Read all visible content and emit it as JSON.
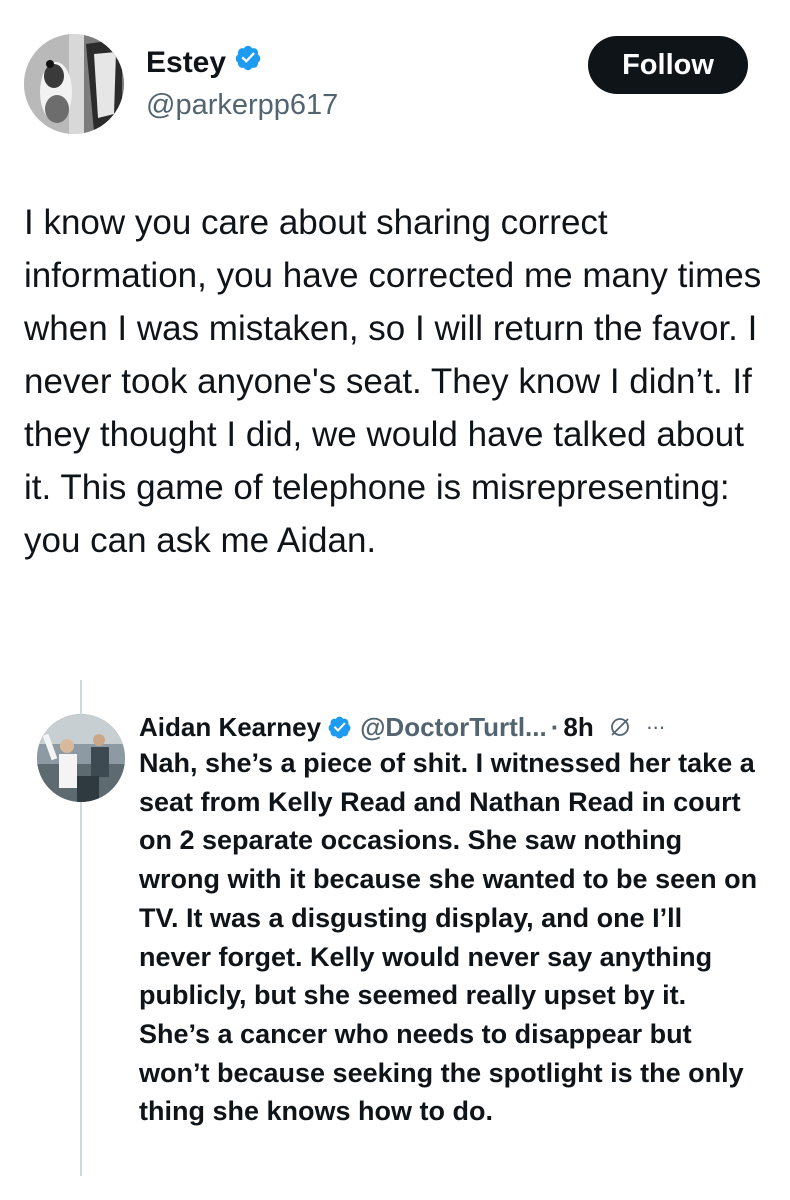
{
  "author": {
    "display_name": "Estey",
    "handle": "@parkerpp617",
    "verified": true,
    "avatar_icon": "profile-photo"
  },
  "follow_button": {
    "label": "Follow"
  },
  "tweet": {
    "text": "I know you care about sharing correct information, you have corrected me many times when I was mistaken, so I will return the favor. I never took anyone's seat. They know I didn’t. If they thought I did, we would have talked about it. This game of telephone is misrepresenting: you can ask me Aidan."
  },
  "quoted_reply": {
    "display_name": "Aidan Kearney",
    "handle": "@DoctorTurtl...",
    "separator": "·",
    "time": "8h",
    "verified": true,
    "text": "Nah, she’s a piece of shit. I witnessed her take a seat from Kelly Read and Nathan Read in court on 2 separate occasions. She saw nothing wrong with it because she wanted to be seen on TV. It was a disgusting display, and one I’ll never forget. Kelly would never say anything publicly, but she seemed really upset by it. She’s a cancer who needs to disappear but won’t because seeking the spotlight is the only thing she knows how to do."
  },
  "icons": {
    "verified": "verified-badge-icon",
    "grok": "grok-icon",
    "more": "more-icon"
  },
  "colors": {
    "verified_blue": "#1d9bf0",
    "text_primary": "#0f1419",
    "text_secondary": "#536471",
    "button_bg": "#0f1419"
  }
}
